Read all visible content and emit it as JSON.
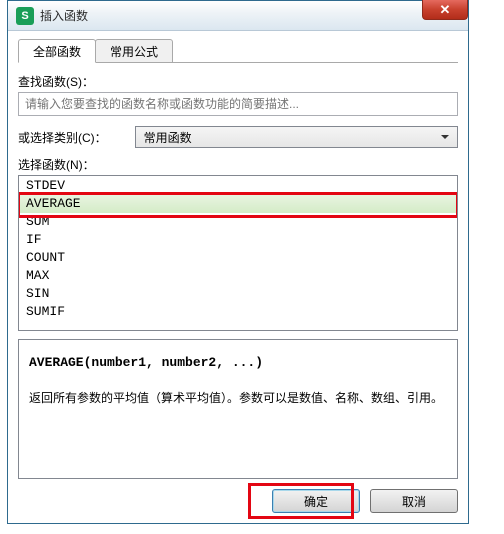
{
  "window": {
    "title": "插入函数",
    "app_icon_letter": "S"
  },
  "tabs": {
    "all": "全部函数",
    "common": "常用公式"
  },
  "search": {
    "label": "查找函数(S)：",
    "placeholder": "请输入您要查找的函数名称或函数功能的简要描述..."
  },
  "category": {
    "label": "或选择类别(C)：",
    "value": "常用函数"
  },
  "list": {
    "label": "选择函数(N)：",
    "items": [
      "STDEV",
      "AVERAGE",
      "SUM",
      "IF",
      "COUNT",
      "MAX",
      "SIN",
      "SUMIF"
    ],
    "selected_index": 1
  },
  "detail": {
    "syntax": "AVERAGE(number1, number2, ...)",
    "description": "返回所有参数的平均值（算术平均值）。参数可以是数值、名称、数组、引用。"
  },
  "buttons": {
    "ok": "确定",
    "cancel": "取消"
  }
}
